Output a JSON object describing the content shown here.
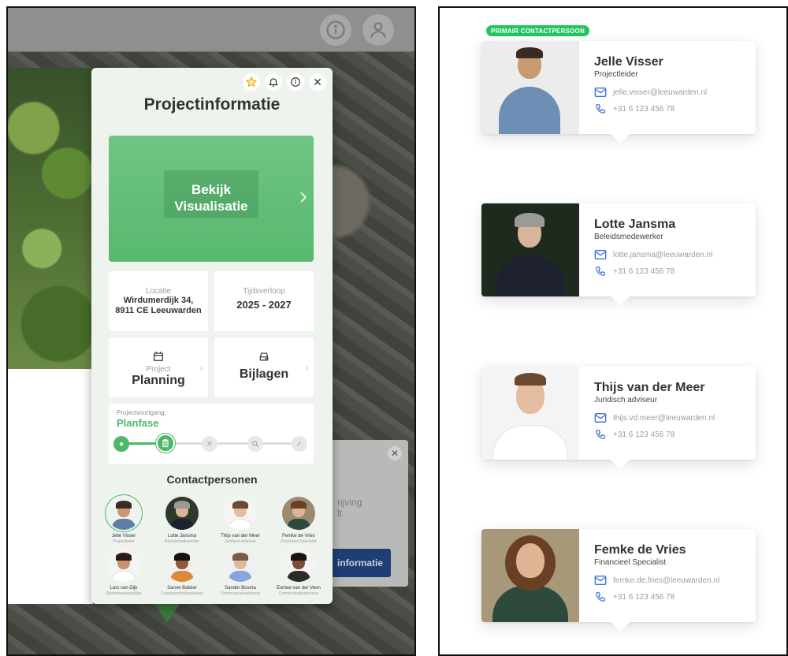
{
  "left": {
    "panel": {
      "title": "Projectinformatie",
      "visual_label_1": "Bekijk",
      "visual_label_2": "Visualisatie",
      "location_label": "Locatie",
      "location_line1": "Wirdumerdijk 34,",
      "location_line2": "8911 CE Leeuwarden",
      "timeline_label": "Tijdsverloop",
      "timeline_value": "2025 - 2027",
      "planning_small": "Project",
      "planning_big": "Planning",
      "attachments": "Bijlagen",
      "progress_label": "Projectvoortgang:",
      "progress_phase": "Planfase",
      "progress_fraction": 0.25,
      "contacts_title": "Contactpersonen",
      "contacts": [
        {
          "name": "Jelle Visser",
          "role": "Projectleider"
        },
        {
          "name": "Lotte Jansma",
          "role": "Beleidsmedewerker"
        },
        {
          "name": "Thijs van der Meer",
          "role": "Juridisch adviseur"
        },
        {
          "name": "Femke de Vries",
          "role": "Financieel Specialist"
        },
        {
          "name": "Lars van Dijk",
          "role": "Stedenbouwkundige"
        },
        {
          "name": "Sanne Bakker",
          "role": "Duurzaamheidsadviseur"
        },
        {
          "name": "Sander Bosma",
          "role": "Communicatieadviseur"
        },
        {
          "name": "Esmee van der Veen",
          "role": "Communicatieadviseur"
        }
      ]
    },
    "bg_popup": {
      "text_1": "rijving",
      "text_2": "lt",
      "button": "informatie"
    }
  },
  "right": {
    "primary_badge": "PRIMAIR CONTACTPERSOON",
    "cards": [
      {
        "name": "Jelle Visser",
        "role": "Projectleider",
        "email": "jelle.visser@leeuwarden.nl",
        "phone": "+31 6 123 456 78"
      },
      {
        "name": "Lotte Jansma",
        "role": "Beleidsmedewerker",
        "email": "lotte.jansma@leeuwarden.nl",
        "phone": "+31 6 123 456 78"
      },
      {
        "name": "Thijs van der Meer",
        "role": "Juridisch adviseur",
        "email": "thijs.vd.meer@leeuwarden.nl",
        "phone": "+31 6 123 456 78"
      },
      {
        "name": "Femke de Vries",
        "role": "Financieel Specialist",
        "email": "femke.de.fries@leeuwarden.nl",
        "phone": "+31 6 123 456 78"
      }
    ]
  },
  "colors": {
    "accent_green": "#4cb868",
    "badge_green": "#22c55e",
    "link_blue": "#3b6fd8"
  }
}
